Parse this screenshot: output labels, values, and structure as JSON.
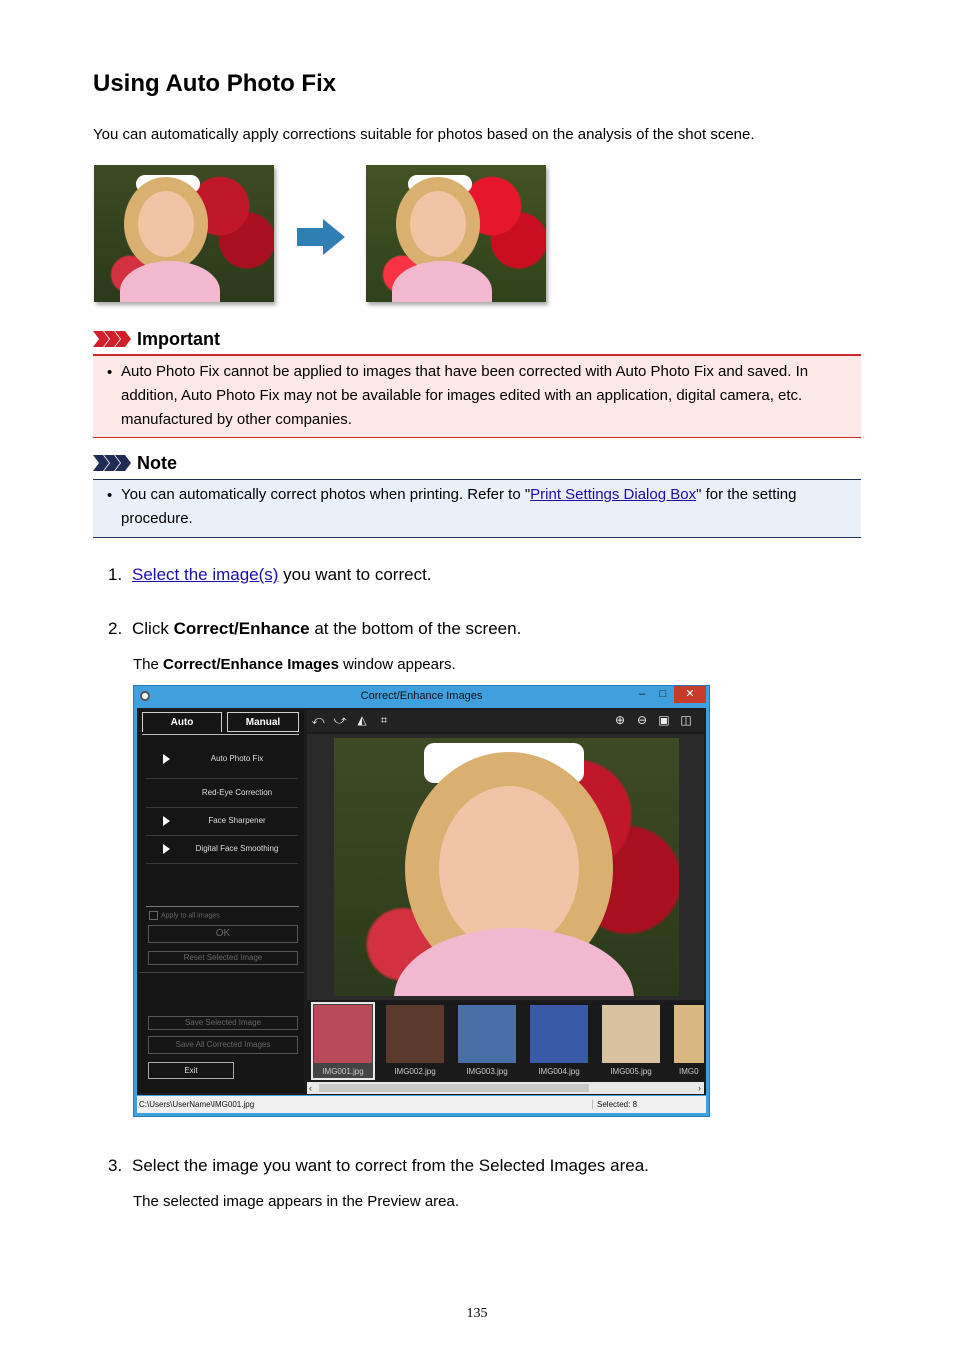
{
  "page": {
    "title": "Using Auto Photo Fix",
    "intro": "You can automatically apply corrections suitable for photos based on the analysis of the shot scene.",
    "page_number": "135"
  },
  "important": {
    "label": "Important",
    "text": "Auto Photo Fix cannot be applied to images that have been corrected with Auto Photo Fix and saved. In addition, Auto Photo Fix may not be available for images edited with an application, digital camera, etc. manufactured by other companies.",
    "accent": "#cc2a2a"
  },
  "note": {
    "label": "Note",
    "text_before": "You can automatically correct photos when printing. Refer to \"",
    "link": "Print Settings Dialog Box",
    "text_after": "\" for the setting procedure.",
    "accent": "#20305a"
  },
  "steps": [
    {
      "num": "1.",
      "link": "Select the image(s)",
      "text": " you want to correct."
    },
    {
      "num": "2.",
      "pre": "Click ",
      "bold": "Correct/Enhance",
      "post": " at the bottom of the screen.",
      "sub_pre": "The ",
      "sub_bold": "Correct/Enhance Images",
      "sub_post": " window appears."
    },
    {
      "num": "3.",
      "text": "Select the image you want to correct from the Selected Images area.",
      "sub": "The selected image appears in the Preview area."
    }
  ],
  "window": {
    "title": "Correct/Enhance Images",
    "min": "–",
    "max": "□",
    "close": "✕",
    "tabs": {
      "auto": "Auto",
      "manual": "Manual"
    },
    "tools": [
      "Auto Photo Fix",
      "Red-Eye Correction",
      "Face Sharpener",
      "Digital Face Smoothing"
    ],
    "apply_all": "Apply to all images",
    "ok": "OK",
    "reset": "Reset Selected Image",
    "save_selected": "Save Selected Image",
    "save_all": "Save All Corrected Images",
    "exit": "Exit",
    "thumbnails": [
      "IMG001.jpg",
      "IMG002.jpg",
      "IMG003.jpg",
      "IMG004.jpg",
      "IMG005.jpg",
      "IMG0"
    ],
    "status_path": "C:\\Users\\UserName\\IMG001.jpg",
    "status_selected": "Selected: 8"
  }
}
